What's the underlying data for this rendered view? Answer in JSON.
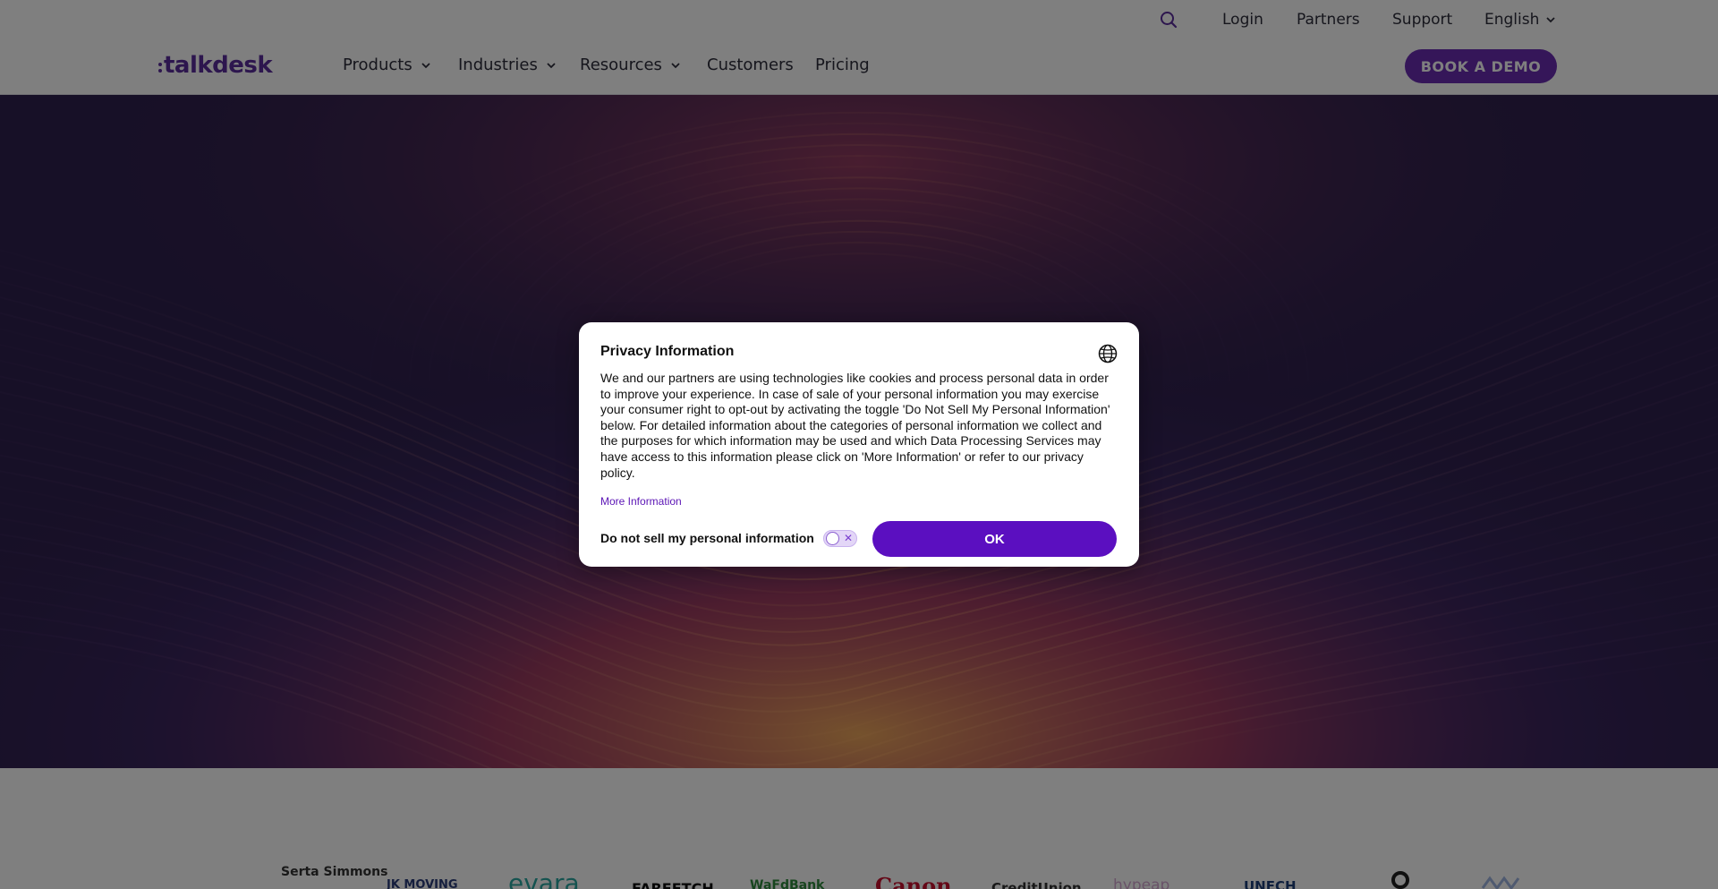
{
  "utility_bar": {
    "search_icon": "search-icon",
    "links": [
      "Login",
      "Partners",
      "Support"
    ],
    "language": "English"
  },
  "nav": {
    "logo_text": "talkdesk",
    "items": [
      {
        "label": "Products",
        "has_dropdown": true
      },
      {
        "label": "Industries",
        "has_dropdown": true
      },
      {
        "label": "Resources",
        "has_dropdown": true
      },
      {
        "label": "Customers",
        "has_dropdown": false
      },
      {
        "label": "Pricing",
        "has_dropdown": false
      }
    ],
    "cta_label": "BOOK A DEMO"
  },
  "brands": [
    "Serta Simmons",
    "JK MOVING",
    "evara",
    "FARFETCH",
    "WaFdBank",
    "Canon",
    "CreditUnion",
    "hypeap",
    "UNECH"
  ],
  "privacy_modal": {
    "title": "Privacy Information",
    "body": "We and our partners are using technologies like cookies and process personal data in order to improve your experience. In case of sale of your personal information you may exercise your consumer right to opt-out by activating the toggle 'Do Not Sell My Personal Information' below. For detailed information about the categories of personal information we collect and the purposes for which information may be used and which Data Processing Services may have access to this information please click on 'More Information' or refer to our privacy policy.",
    "more_info_label": "More Information",
    "do_not_sell_label": "Do not sell my personal information",
    "do_not_sell_enabled": false,
    "ok_label": "OK"
  },
  "colors": {
    "brand_purple": "#5b2d9c",
    "cta_purple": "#6a2db3",
    "ok_purple": "#5b0fc0",
    "hero_bg": "#2f214e"
  }
}
